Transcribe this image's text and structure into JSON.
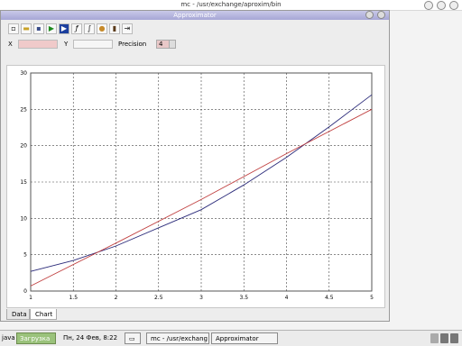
{
  "background_window": {
    "title": "mc - /usr/exchange/aproxim/bin"
  },
  "app": {
    "title": "Approximator",
    "toolbar_icons": [
      "new-file-icon",
      "open-folder-icon",
      "save-icon",
      "run-icon",
      "step-icon",
      "function-icon",
      "integral-icon",
      "hand-icon",
      "book-icon",
      "exit-icon"
    ],
    "params": {
      "x_label": "X",
      "x_value": "",
      "y_label": "Y",
      "y_value": "",
      "precision_label": "Precision",
      "precision_value": "4"
    },
    "tabs": [
      {
        "label": "Data",
        "active": false
      },
      {
        "label": "Chart",
        "active": true
      }
    ]
  },
  "chart_data": {
    "type": "line",
    "x_ticks": [
      "1",
      "1.5",
      "2",
      "2.5",
      "3",
      "3.5",
      "4",
      "4.5",
      "5"
    ],
    "y_ticks": [
      "0",
      "5",
      "10",
      "15",
      "20",
      "25",
      "30"
    ],
    "xlim": [
      1,
      5
    ],
    "ylim": [
      0,
      30
    ],
    "grid": true,
    "series": [
      {
        "color": "#2b2b7a",
        "x": [
          1,
          1.5,
          2,
          2.5,
          3,
          3.5,
          4,
          4.5,
          5
        ],
        "y": [
          2.7,
          4.2,
          6.2,
          8.7,
          11.2,
          14.6,
          18.4,
          22.6,
          27.0
        ]
      },
      {
        "color": "#c04040",
        "x": [
          1,
          2,
          3,
          4,
          5
        ],
        "y": [
          0.7,
          6.6,
          12.6,
          18.9,
          25.0
        ]
      }
    ]
  },
  "taskbar": {
    "java_label": "java",
    "loading_label": "Загрузка",
    "datetime": "Пн, 24 Фев,  8:22",
    "tasks": [
      {
        "label": "mc - /usr/exchang"
      },
      {
        "label": "Approximator"
      }
    ]
  }
}
